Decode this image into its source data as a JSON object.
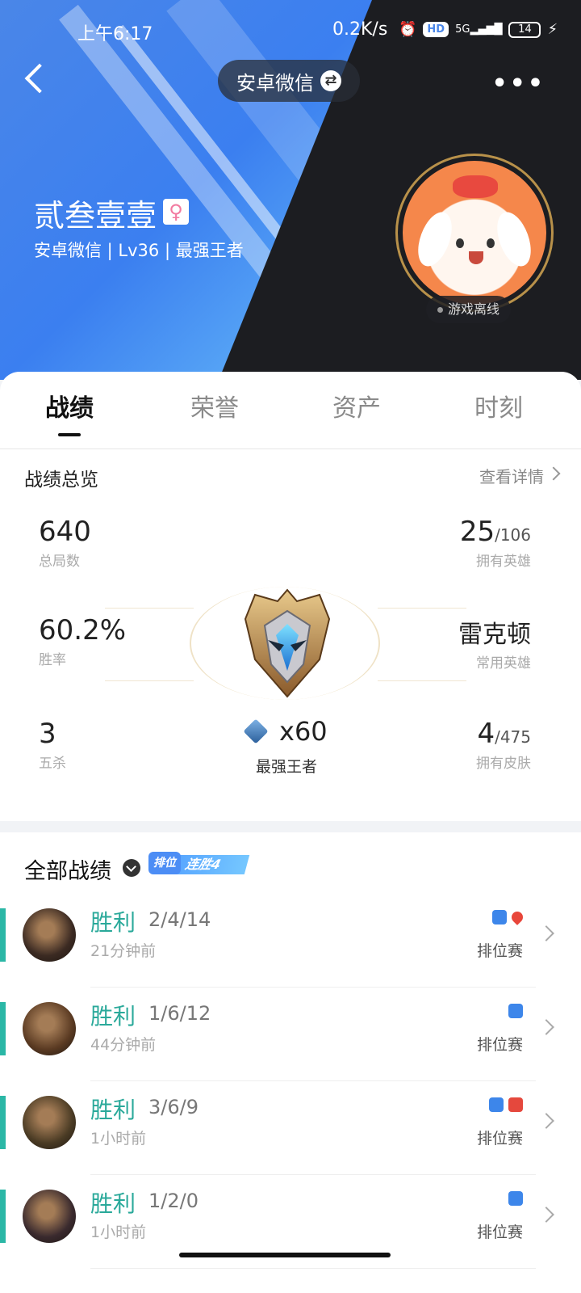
{
  "status": {
    "time": "上午6:17",
    "speed": "0.2K/s",
    "hd": "HD",
    "net": "5G",
    "battery": "14"
  },
  "header": {
    "account_switch": "安卓微信",
    "username": "贰叁壹壹",
    "gender_symbol": "♀",
    "subinfo": "安卓微信 | Lv36 | 最强王者",
    "online_status": "游戏离线"
  },
  "tabs": [
    "战绩",
    "荣誉",
    "资产",
    "时刻"
  ],
  "overview": {
    "title": "战绩总览",
    "detail_link": "查看详情",
    "total_games": {
      "value": "640",
      "label": "总局数"
    },
    "heroes_owned": {
      "value": "25",
      "total": "/106",
      "label": "拥有英雄"
    },
    "win_rate": {
      "value": "60.2%",
      "label": "胜率"
    },
    "common_hero": {
      "value": "雷克顿",
      "label": "常用英雄"
    },
    "penta_kills": {
      "value": "3",
      "label": "五杀"
    },
    "skins_owned": {
      "value": "4",
      "total": "/475",
      "label": "拥有皮肤"
    },
    "rank_stars": "x60",
    "rank_name": "最强王者"
  },
  "matches": {
    "title": "全部战绩",
    "streak_tag": "排位",
    "streak_text": "连胜4",
    "items": [
      {
        "result": "胜利",
        "kda": "2/4/14",
        "ago": "21分钟前",
        "mode": "排位赛",
        "avatar_color": "#3b2a22"
      },
      {
        "result": "胜利",
        "kda": "1/6/12",
        "ago": "44分钟前",
        "mode": "排位赛",
        "avatar_color": "#5a3a22"
      },
      {
        "result": "胜利",
        "kda": "3/6/9",
        "ago": "1小时前",
        "mode": "排位赛",
        "avatar_color": "#4a3b24"
      },
      {
        "result": "胜利",
        "kda": "1/2/0",
        "ago": "1小时前",
        "mode": "排位赛",
        "avatar_color": "#3a2a2e"
      }
    ]
  },
  "colors": {
    "win": "#2aa99a",
    "win_bar": "#2bb7a6",
    "accent": "#3d86ea"
  }
}
